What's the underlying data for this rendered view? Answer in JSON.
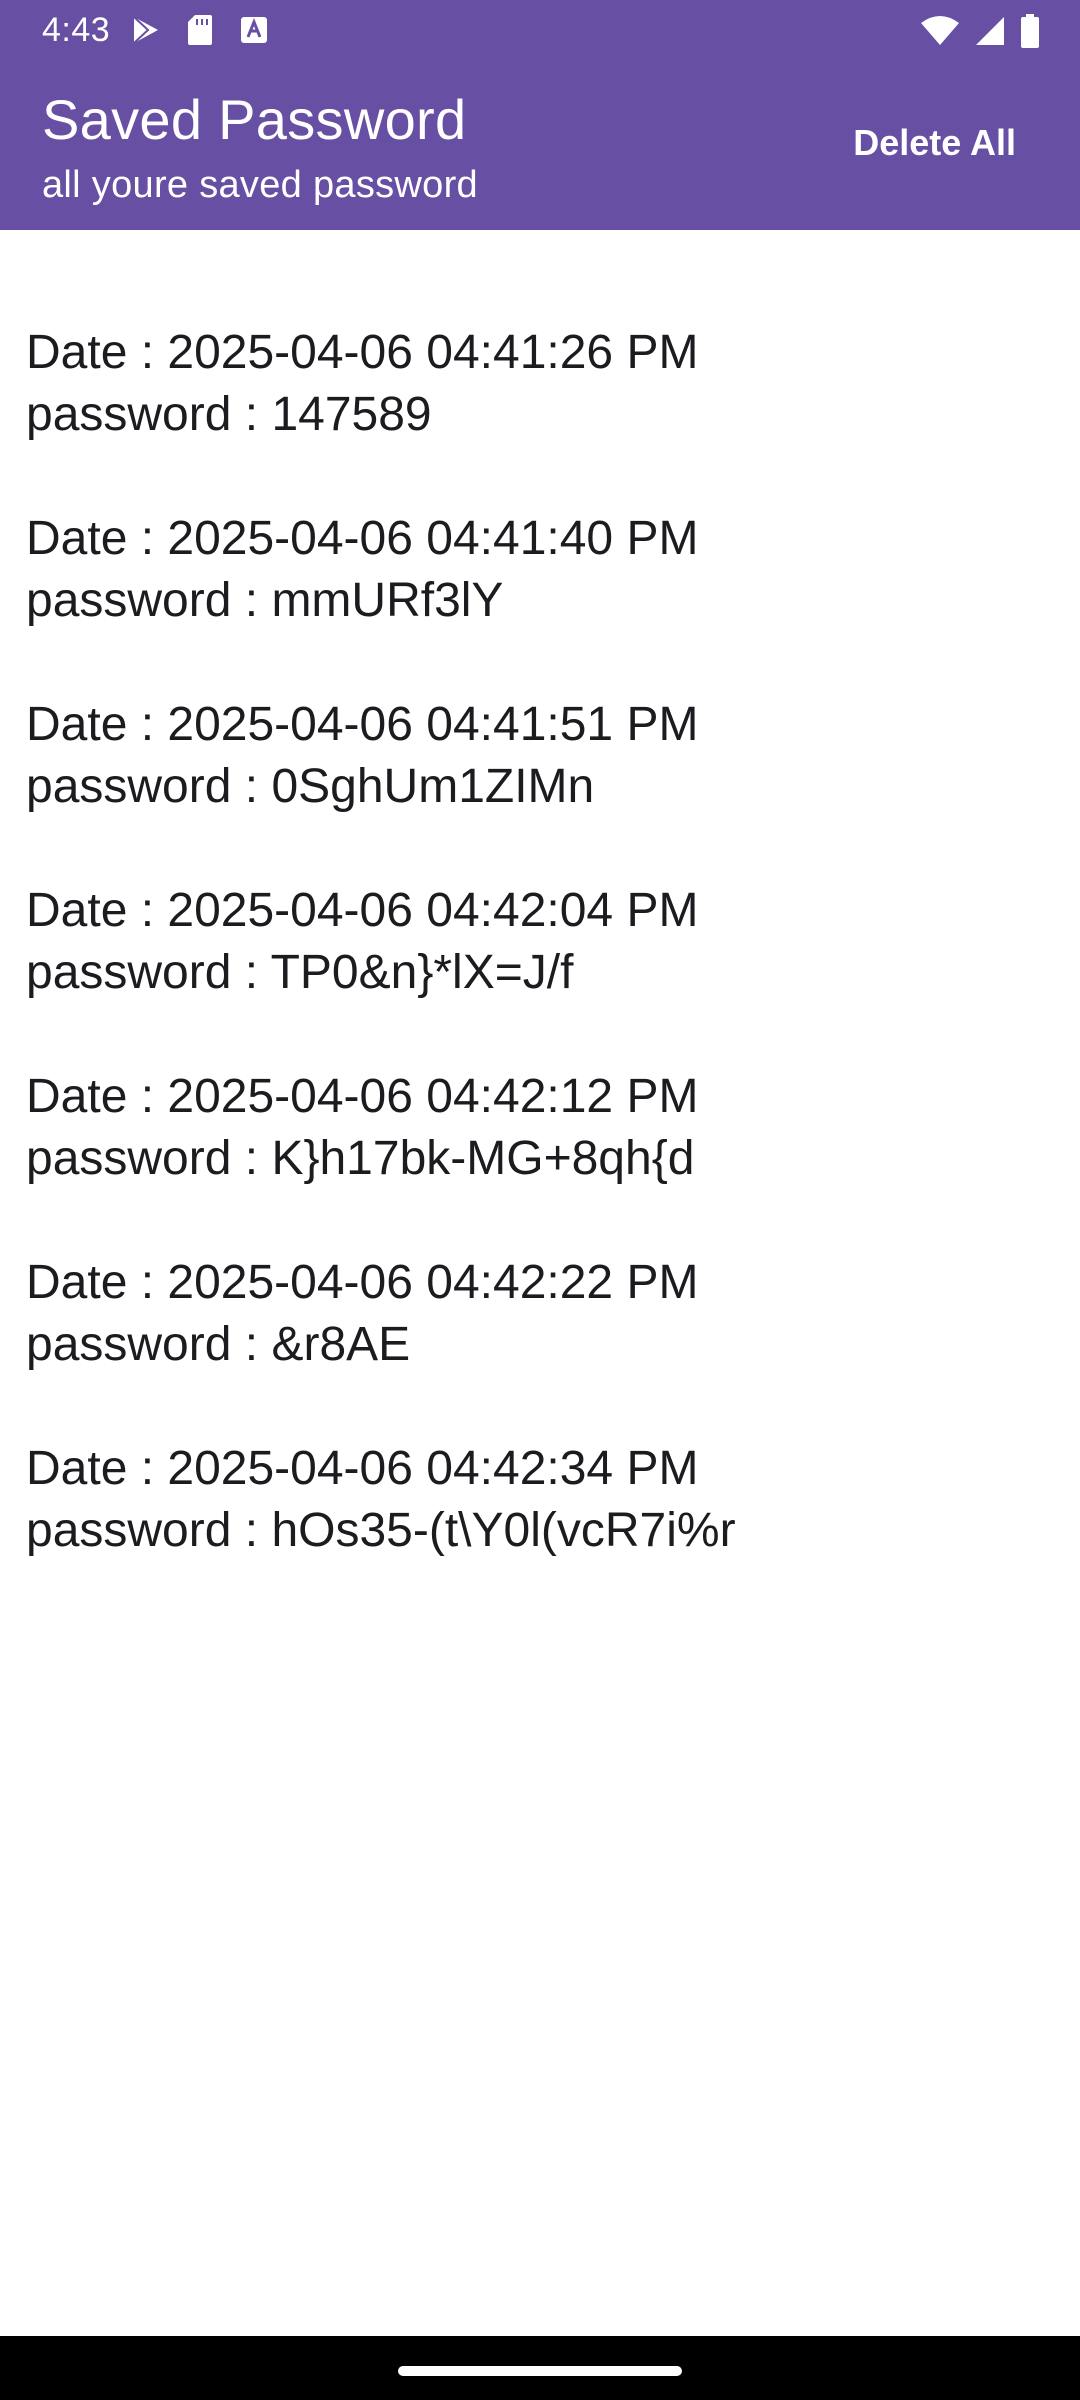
{
  "status_bar": {
    "time": "4:43",
    "left_icons": [
      "play-store-icon",
      "sd-card-icon",
      "keyboard-a-icon"
    ],
    "right_icons": [
      "wifi-icon",
      "signal-icon",
      "battery-icon"
    ]
  },
  "app_bar": {
    "title": "Saved Password",
    "subtitle": "all youre saved password",
    "delete_all_label": "Delete All",
    "color": "#6750a4"
  },
  "entries": [
    {
      "date": "Date : 2025-04-06 04:41:26 PM",
      "password": "password : 147589"
    },
    {
      "date": "Date : 2025-04-06 04:41:40 PM",
      "password": "password : mmURf3lY"
    },
    {
      "date": "Date : 2025-04-06 04:41:51 PM",
      "password": "password : 0SghUm1ZIMn"
    },
    {
      "date": "Date : 2025-04-06 04:42:04 PM",
      "password": "password : TP0&n}*lX=J/f"
    },
    {
      "date": "Date : 2025-04-06 04:42:12 PM",
      "password": "password : K}h17bk-MG+8qh{d"
    },
    {
      "date": "Date : 2025-04-06 04:42:22 PM",
      "password": "password : &r8AE"
    },
    {
      "date": "Date : 2025-04-06 04:42:34 PM",
      "password": "password : hOs35-(t\\Y0l(vcR7i%r"
    }
  ]
}
